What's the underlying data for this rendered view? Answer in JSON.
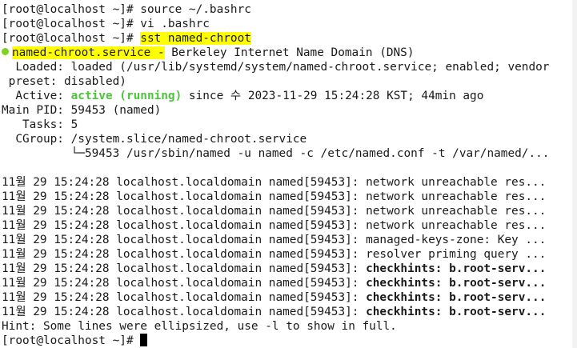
{
  "terminal": {
    "lines": {
      "cmd1": "[root@localhost ~]# source ~/.bashrc",
      "cmd2": "[root@localhost ~]# vi .bashrc",
      "prompt3": "[root@localhost ~]# ",
      "cmd3": "sst named-chroot",
      "unit_name": "named-chroot.service -",
      "unit_desc": " Berkeley Internet Name Domain (DNS)",
      "loaded1": "  Loaded: loaded (/usr/lib/systemd/system/named-chroot.service; enabled; vendor",
      "loaded2": " preset: disabled)",
      "active_label": "  Active: ",
      "active_state": "active (running)",
      "active_since": " since 수 2023-11-29 15:24:28 KST; 44min ago",
      "mainpid": "Main PID: 59453 (named)",
      "tasks": "   Tasks: 5",
      "cgroup": "  CGroup: /system.slice/named-chroot.service",
      "cgroup_child": "          └─59453 /usr/sbin/named -u named -c /etc/named.conf -t /var/named/...",
      "blank": "",
      "log1": "11월 29 15:24:28 localhost.localdomain named[59453]: network unreachable res...",
      "log2": "11월 29 15:24:28 localhost.localdomain named[59453]: network unreachable res...",
      "log3": "11월 29 15:24:28 localhost.localdomain named[59453]: network unreachable res...",
      "log4": "11월 29 15:24:28 localhost.localdomain named[59453]: network unreachable res...",
      "log5": "11월 29 15:24:28 localhost.localdomain named[59453]: managed-keys-zone: Key ...",
      "log6": "11월 29 15:24:28 localhost.localdomain named[59453]: resolver priming query ...",
      "log7_prefix": "11월 29 15:24:28 localhost.localdomain named[59453]: ",
      "log7_bold": "checkhints: b.root-serv...",
      "log8_prefix": "11월 29 15:24:28 localhost.localdomain named[59453]: ",
      "log8_bold": "checkhints: b.root-serv...",
      "log9_prefix": "11월 29 15:24:28 localhost.localdomain named[59453]: ",
      "log9_bold": "checkhints: b.root-serv...",
      "log10_prefix": "11월 29 15:24:28 localhost.localdomain named[59453]: ",
      "log10_bold": "checkhints: b.root-serv...",
      "hint": "Hint: Some lines were ellipsized, use -l to show in full.",
      "final_prompt": "[root@localhost ~]# "
    },
    "colors": {
      "highlight": "#ffff00",
      "active_green": "#4ec43d",
      "status_dot": "#7ed321"
    }
  }
}
